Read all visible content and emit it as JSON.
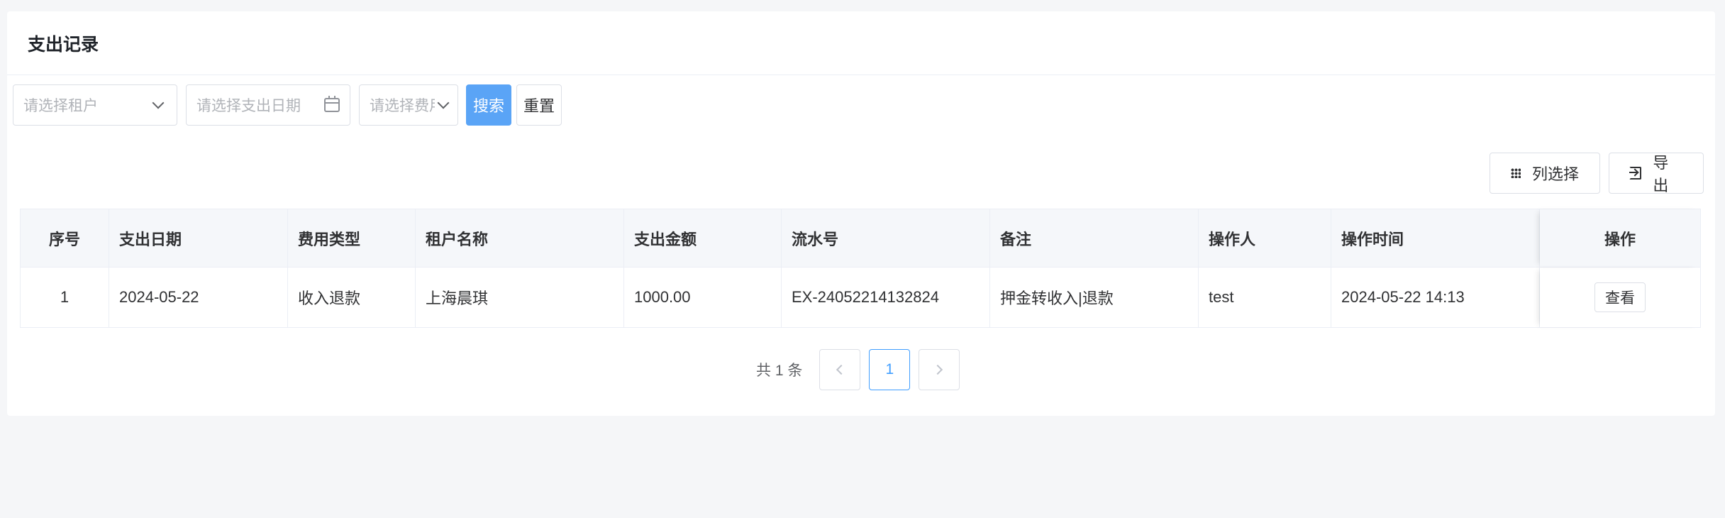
{
  "page": {
    "title": "支出记录"
  },
  "filters": {
    "tenant_placeholder": "请选择租户",
    "date_placeholder": "请选择支出日期",
    "fee_type_placeholder": "请选择费用类型",
    "search_label": "搜索",
    "reset_label": "重置"
  },
  "toolbar": {
    "column_select_label": "列选择",
    "export_label": "导出"
  },
  "table": {
    "headers": [
      "序号",
      "支出日期",
      "费用类型",
      "租户名称",
      "支出金额",
      "流水号",
      "备注",
      "操作人",
      "操作时间",
      "操作"
    ],
    "rows": [
      {
        "index": "1",
        "date": "2024-05-22",
        "fee_type": "收入退款",
        "tenant": "上海晨琪",
        "amount": "1000.00",
        "serial": "EX-24052214132824",
        "remark": "押金转收入|退款",
        "operator": "test",
        "op_time": "2024-05-22 14:13",
        "action": "查看"
      }
    ]
  },
  "pagination": {
    "total_text": "共 1 条",
    "current_page": "1"
  },
  "colors": {
    "primary": "#5aa4f6",
    "page_active": "#409eff"
  }
}
